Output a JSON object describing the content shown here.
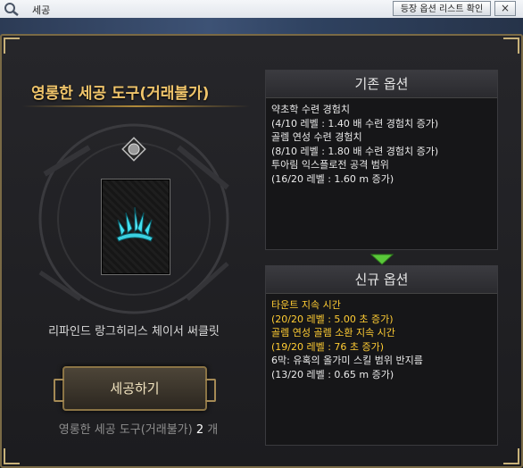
{
  "window": {
    "title": "세공",
    "list_button": "등장 옵션 리스트 확인",
    "close_symbol": "×"
  },
  "left": {
    "item_title": "영롱한 세공 도구(거래불가)",
    "item_name": "리파인드 랑그히리스 체이서 써클릿",
    "craft_button": "세공하기",
    "tool_count_label": "영롱한 세공 도구(거래불가)",
    "tool_count": "2",
    "tool_count_unit": "개"
  },
  "existing": {
    "header": "기존 옵션",
    "options": [
      {
        "name": "약초학 수련 경험치",
        "value": "(4/10 레벨 : 1.40 배 수련 경험치 증가)"
      },
      {
        "name": "골렘 연성 수련 경험치",
        "value": "(8/10 레벨 : 1.80 배 수련 경험치 증가)"
      },
      {
        "name": "투아림 익스플로전 공격 범위",
        "value": "(16/20 레벨 : 1.60 m 증가)"
      }
    ]
  },
  "new": {
    "header": "신규 옵션",
    "options": [
      {
        "name": "타운트 지속 시간",
        "value": "(20/20 레벨 : 5.00 초 증가)",
        "highlight": true
      },
      {
        "name": "골렘 연성 골렘 소환 지속 시간",
        "value": "(19/20 레벨 : 76 초 증가)",
        "highlight": true
      },
      {
        "name": "6막: 유혹의 올가미 스킬 범위 반지름",
        "value": "(13/20 레벨 : 0.65 m 증가)",
        "highlight": false
      }
    ]
  },
  "colors": {
    "accent_gold": "#f0c56b",
    "highlight_yellow": "#ffcc33",
    "frame_border": "#7a6a45"
  },
  "icons": [
    "search-icon",
    "close-icon",
    "gem-slot-icon",
    "crown-icon",
    "down-arrow-icon"
  ]
}
